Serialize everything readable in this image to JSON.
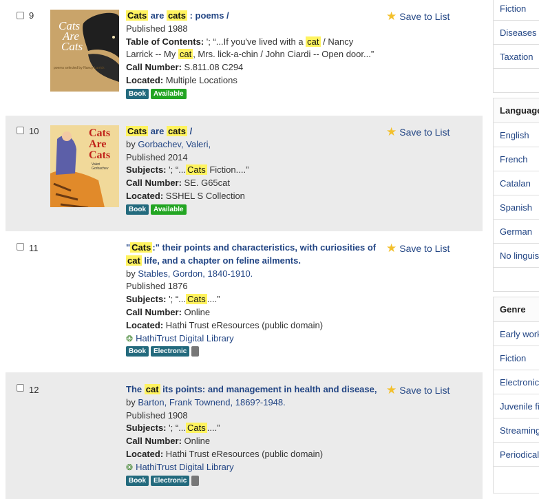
{
  "results": [
    {
      "number": "9",
      "title_parts": [
        {
          "text": "Cats",
          "hl": true
        },
        {
          "text": " are ",
          "hl": false
        },
        {
          "text": "cats",
          "hl": true
        },
        {
          "text": " : poems /",
          "hl": false
        }
      ],
      "published": "Published 1988",
      "toc_label": "Table of Contents:",
      "toc_line1_a": " '; “...If you've lived with a ",
      "toc_line1_hl": "cat",
      "toc_line1_b": " / Nancy",
      "toc_line2_a": "Larrick -- My ",
      "toc_line2_hl": "cat",
      "toc_line2_b": ", Mrs. lick-a-chin / John Ciardi -- Open door...”",
      "call_label": "Call Number:",
      "call_value": " S.811.08 C294",
      "located_label": "Located:",
      "located_value": " Multiple Locations",
      "badges": [
        "Book",
        "Available"
      ],
      "cover": {
        "line1": "Cats",
        "line2": "Are",
        "line3": "Cats"
      }
    },
    {
      "number": "10",
      "title_parts": [
        {
          "text": "Cats",
          "hl": true
        },
        {
          "text": " are ",
          "hl": false
        },
        {
          "text": "cats",
          "hl": true
        },
        {
          "text": " /",
          "hl": false
        }
      ],
      "author_prefix": "by ",
      "author": "Gorbachev, Valeri,",
      "published": "Published 2014",
      "subjects_label": "Subjects:",
      "subjects_a": " '; “...",
      "subjects_hl": "Cats",
      "subjects_b": " Fiction....”",
      "call_label": "Call Number:",
      "call_value": " SE. G65cat",
      "located_label": "Located:",
      "located_value": " SSHEL S Collection",
      "badges": [
        "Book",
        "Available"
      ],
      "cover": {
        "line1": "Cats",
        "line2": "Are",
        "line3": "Cats",
        "author": "Valeri Gorbachev"
      }
    },
    {
      "number": "11",
      "title_line1_pre": "\"",
      "title_line1_hl": "Cats",
      "title_line1_post": ":\" their points and characteristics, with curiosities of",
      "title_line2_hl": "cat",
      "title_line2_post": " life, and a chapter on feline ailments.",
      "author_prefix": "by ",
      "author": "Stables, Gordon, 1840-1910.",
      "published": "Published 1876",
      "subjects_label": "Subjects:",
      "subjects_a": " '; “...",
      "subjects_hl": "Cats",
      "subjects_b": "....”",
      "call_label": "Call Number:",
      "call_value": " Online",
      "located_label": "Located:",
      "located_value": " Hathi Trust eResources (public domain)",
      "online_link": "HathiTrust Digital Library",
      "badges": [
        "Book",
        "Electronic"
      ]
    },
    {
      "number": "12",
      "title_pre": "The ",
      "title_hl": "cat",
      "title_post": " its points: and management in health and disease,",
      "author_prefix": "by ",
      "author": "Barton, Frank Townend, 1869?-1948.",
      "published": "Published 1908",
      "subjects_label": "Subjects:",
      "subjects_a": " '; “...",
      "subjects_hl": "Cats",
      "subjects_b": "....”",
      "call_label": "Call Number:",
      "call_value": " Online",
      "located_label": "Located:",
      "located_value": " Hathi Trust eResources (public domain)",
      "online_link": "HathiTrust Digital Library",
      "badges": [
        "Book",
        "Electronic"
      ]
    }
  ],
  "save_label": "Save to List",
  "facets": {
    "top_items": [
      "Fiction",
      "Diseases",
      "Taxation"
    ],
    "language": {
      "heading": "Language",
      "items": [
        "English",
        "French",
        "Catalan",
        "Spanish",
        "German",
        "No linguistic content"
      ]
    },
    "genre": {
      "heading": "Genre",
      "items": [
        "Early works",
        "Fiction",
        "Electronic books",
        "Juvenile fiction",
        "Streaming",
        "Periodicals"
      ]
    }
  },
  "colors": {
    "highlight": "#fff35f",
    "link": "#224584",
    "available": "#22a522",
    "book_badge": "#236a7d",
    "star": "#f3c02c"
  }
}
